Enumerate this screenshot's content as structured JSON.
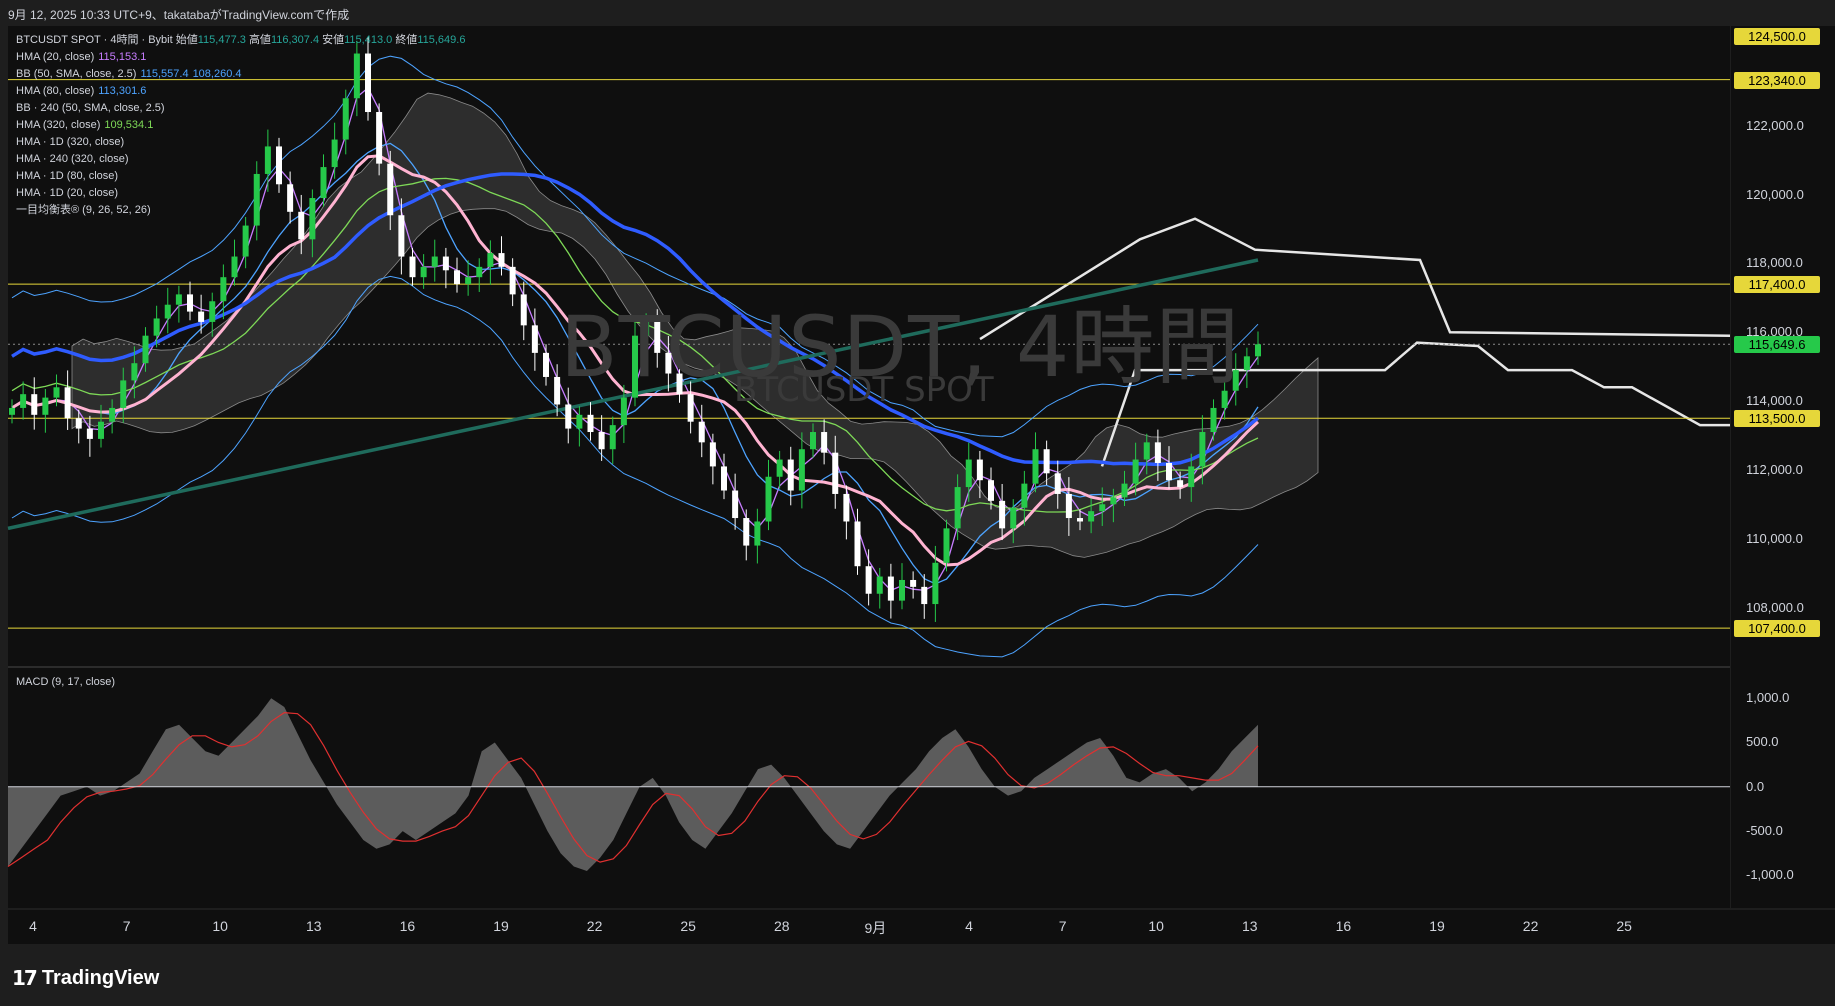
{
  "header": {
    "title": "9月 12, 2025 10:33 UTC+9、takatabaがTradingView.comで作成"
  },
  "symbol_line": {
    "name": "BTCUSDT SPOT · 4時間 · Bybit",
    "open_label": "始値",
    "open": "115,477.3",
    "high_label": "高値",
    "high": "116,307.4",
    "low_label": "安値",
    "low": "115,413.0",
    "close_label": "終値",
    "close": "115,649.6"
  },
  "indicators": [
    {
      "label": "HMA (20, close)",
      "value": "115,153.1",
      "color": "#c77dff"
    },
    {
      "label": "BB (50, SMA, close, 2.5)",
      "value": "115,557.4",
      "value2": "108,260.4",
      "color": "#4da3ff"
    },
    {
      "label": "HMA (80, close)",
      "value": "113,301.6",
      "color": "#4da3ff"
    },
    {
      "label": "BB · 240 (50, SMA, close, 2.5)",
      "value": "",
      "color": "#4da3ff"
    },
    {
      "label": "HMA (320, close)",
      "value": "109,534.1",
      "color": "#7ed957"
    },
    {
      "label": "HMA · 1D (320, close)",
      "value": "",
      "color": "#d1d4dc"
    },
    {
      "label": "HMA · 240 (320, close)",
      "value": "",
      "color": "#d1d4dc"
    },
    {
      "label": "HMA · 1D (80, close)",
      "value": "",
      "color": "#d1d4dc"
    },
    {
      "label": "HMA · 1D (20, close)",
      "value": "",
      "color": "#d1d4dc"
    },
    {
      "label": "一目均衡表® (9, 26, 52, 26)",
      "value": "",
      "color": "#d1d4dc"
    }
  ],
  "watermark": {
    "main": "BTCUSDT, 4時間",
    "sub": "BTCUSDT SPOT"
  },
  "macd": {
    "title": "MACD (9, 17, close)"
  },
  "colors": {
    "background": "#0f0f0f",
    "up": "#26c94a",
    "down": "#ffffff",
    "hline": "#e6d73a",
    "hma20": "#c77dff",
    "hma80": "#4da3ff",
    "hma320": "#7ed957",
    "hma1d80": "#2f5cff",
    "hma1d20": "#ffb3d1",
    "hma1d320": "#1f6b5c",
    "ichimoku": "#e6e6e6",
    "current_tag": "#26c94a"
  },
  "chart_data": {
    "type": "candlestick",
    "price_axis": [
      "124,500.0",
      "123,340.0",
      "122,000.0",
      "120,000.0",
      "118,000.0",
      "117,400.0",
      "116,000.0",
      "115,649.6",
      "114,000.0",
      "113,500.0",
      "112,000.0",
      "110,000.0",
      "108,000.0",
      "107,400.0"
    ],
    "horizontal_levels": [
      123340,
      117400,
      113500,
      107400
    ],
    "current_price": 115649.6,
    "top_tag": "124,500.0",
    "ylim": [
      106300,
      124900
    ],
    "date_ticks": [
      "4",
      "7",
      "10",
      "13",
      "16",
      "19",
      "22",
      "25",
      "28",
      "9月",
      "4",
      "7",
      "10",
      "13",
      "16",
      "19",
      "22",
      "25"
    ],
    "close_series": [
      113800,
      114200,
      113600,
      114100,
      114400,
      113500,
      113200,
      112900,
      113400,
      113800,
      114600,
      115100,
      115900,
      116400,
      116800,
      117100,
      116600,
      116300,
      116900,
      117600,
      118200,
      119100,
      120600,
      121400,
      120300,
      119500,
      118700,
      119900,
      120800,
      121600,
      122800,
      124100,
      122400,
      120900,
      119400,
      118200,
      117600,
      117900,
      118200,
      117800,
      117400,
      117600,
      117900,
      118300,
      117900,
      117100,
      116200,
      115400,
      114700,
      113900,
      113200,
      113600,
      113100,
      112600,
      113300,
      114100,
      115900,
      116300,
      115400,
      114800,
      114200,
      113400,
      112800,
      112100,
      111400,
      110600,
      109800,
      110500,
      111800,
      112300,
      111400,
      112600,
      113100,
      112500,
      111300,
      110500,
      109200,
      108400,
      108900,
      108200,
      108800,
      108600,
      108100,
      109300,
      110300,
      111500,
      112300,
      111700,
      111100,
      110300,
      110900,
      111600,
      112600,
      111900,
      111300,
      110600,
      110500,
      110800,
      111000,
      111200,
      111600,
      112300,
      112800,
      112200,
      111700,
      111500,
      112100,
      113100,
      113800,
      114300,
      114900,
      115300,
      115650
    ],
    "macd_axis": [
      "1,000.0",
      "500.0",
      "0.0",
      "-500.0",
      "-1,000.0"
    ],
    "macd_ylim": [
      -1300,
      1250
    ],
    "macd_values": [
      -900,
      -700,
      -500,
      -300,
      -100,
      -50,
      0,
      -100,
      -50,
      50,
      150,
      400,
      650,
      700,
      550,
      400,
      350,
      500,
      650,
      800,
      1000,
      900,
      600,
      300,
      50,
      -200,
      -400,
      -600,
      -700,
      -650,
      -500,
      -600,
      -500,
      -400,
      -300,
      -100,
      400,
      500,
      300,
      100,
      -200,
      -500,
      -750,
      -900,
      -950,
      -800,
      -600,
      -300,
      0,
      100,
      -100,
      -400,
      -600,
      -700,
      -500,
      -300,
      -50,
      200,
      250,
      100,
      -100,
      -300,
      -500,
      -650,
      -700,
      -500,
      -300,
      -100,
      50,
      200,
      400,
      550,
      650,
      450,
      200,
      0,
      -100,
      -50,
      100,
      200,
      300,
      400,
      500,
      550,
      350,
      100,
      50,
      150,
      200,
      100,
      -50,
      50,
      200,
      400,
      550,
      700
    ]
  }
}
